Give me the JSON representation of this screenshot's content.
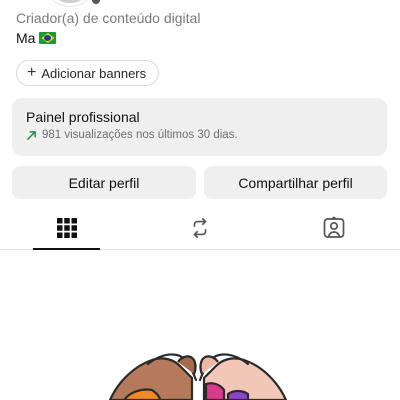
{
  "profile": {
    "category": "Criador(a) de conteúdo digital",
    "bio_text": "Ma",
    "bio_flag": "brazil-flag",
    "add_banners_label": "Adicionar banners"
  },
  "professional_panel": {
    "title": "Painel profissional",
    "subtitle": "981 visualizações nos últimos 30 dias.",
    "trend_color": "#1f8a4c"
  },
  "actions": {
    "edit_label": "Editar perfil",
    "share_label": "Compartilhar perfil"
  },
  "tabs": [
    {
      "icon": "grid-icon",
      "active": true
    },
    {
      "icon": "reels-repost-icon",
      "active": false
    },
    {
      "icon": "tagged-user-icon",
      "active": false
    }
  ]
}
